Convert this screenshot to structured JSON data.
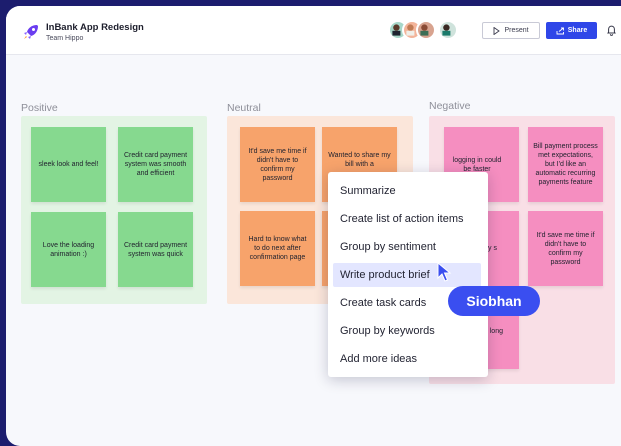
{
  "header": {
    "app_title": "InBank App Redesign",
    "team": "Team Hippo",
    "present_label": "Present",
    "share_label": "Share"
  },
  "columns": {
    "positive": {
      "title": "Positive",
      "notes": [
        "sleek look and feel!",
        "Credit card payment system was smooth and efficient",
        "Love the loading animation :)",
        "Credit card payment system was quick"
      ]
    },
    "neutral": {
      "title": "Neutral",
      "notes": [
        "It'd save me time if didn't have to confirm my password",
        "Wanted to share my bill with a",
        "Hard to know what to do next after confirmation page",
        ""
      ]
    },
    "negative": {
      "title": "Negative",
      "notes": [
        "logging in could be faster",
        "Bill payment process met expectations, but I'd like an automatic recurring payments feature",
        "ny s",
        "It'd save me time if didn't have to confirm my password",
        "me of ment long"
      ]
    }
  },
  "context_menu": {
    "items": [
      "Summarize",
      "Create list of action items",
      "Group by sentiment",
      "Write product brief",
      "Create task cards",
      "Group by  keywords",
      "Add more ideas"
    ],
    "active_index": 3
  },
  "collaborator_tag": "Siobhan",
  "colors": {
    "background": "#1c1d6e",
    "accent": "#2f46e8",
    "positive_note": "#86d98f",
    "neutral_note": "#f7a36b",
    "negative_note": "#f58ec0",
    "positive_group": "#e3f4e4",
    "neutral_group": "#fbe6da",
    "negative_group": "#f9dfe6"
  }
}
